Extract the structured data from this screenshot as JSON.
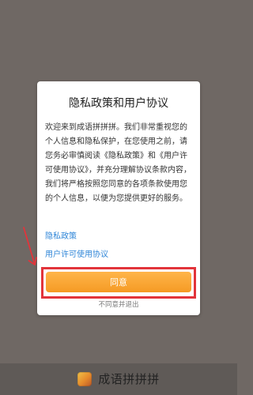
{
  "dialog": {
    "title": "隐私政策和用户协议",
    "body": "欢迎来到成语拼拼拼。我们非常重视您的个人信息和隐私保护，在您使用之前，请您务必审慎阅读《隐私政策》和《用户许可使用协议》，并充分理解协议条款内容，我们将严格按照您同意的各项条款使用您的个人信息，以便为您提供更好的服务。",
    "privacy_link": "隐私政策",
    "agreement_link": "用户许可使用协议",
    "agree_label": "同意",
    "disagree_label": "不同意并退出"
  },
  "bottom_bar": {
    "app_icon": "app-icon",
    "app_name": "成语拼拼拼"
  },
  "colors": {
    "overlay_bg": "#6f6864",
    "link": "#2f86d8",
    "agree_button": "#f59a24",
    "highlight_box": "#e2343b"
  }
}
